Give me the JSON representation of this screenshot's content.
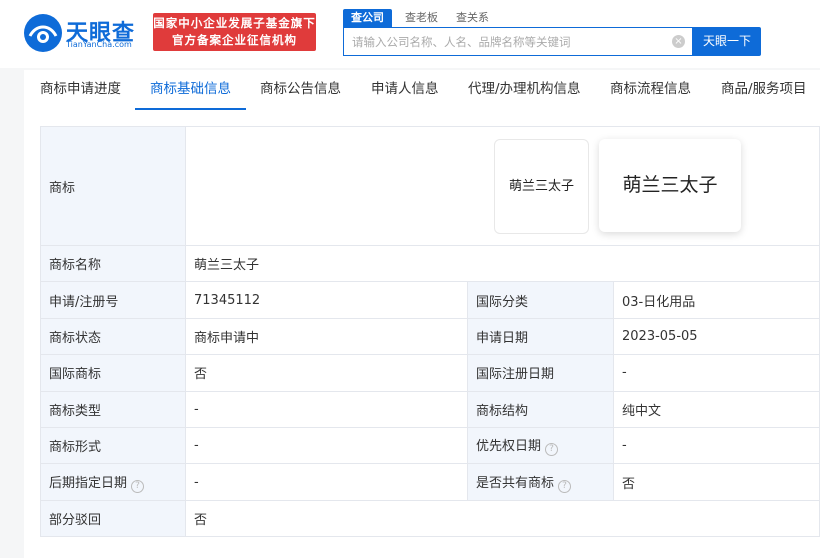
{
  "header": {
    "logo_title": "天眼查",
    "logo_sub": "TianYanCha.com",
    "banner_line1": "国家中小企业发展子基金旗下",
    "banner_line2": "官方备案企业征信机构",
    "search_tabs": [
      "查公司",
      "查老板",
      "查关系"
    ],
    "search_placeholder": "请输入公司名称、人名、品牌名称等关键词",
    "search_button": "天眼一下"
  },
  "nav": {
    "tabs": [
      "商标申请进度",
      "商标基础信息",
      "商标公告信息",
      "申请人信息",
      "代理/办理机构信息",
      "商标流程信息",
      "商品/服务项目"
    ],
    "active": "商标基础信息"
  },
  "trademark": {
    "mark_label": "商标",
    "mark_text": "萌兰三太子",
    "rows": [
      {
        "label": "商标名称",
        "value": "萌兰三太子"
      },
      {
        "label": "申请/注册号",
        "value": "71345112",
        "label2": "国际分类",
        "value2": "03-日化用品"
      },
      {
        "label": "商标状态",
        "value": "商标申请中",
        "label2": "申请日期",
        "value2": "2023-05-05"
      },
      {
        "label": "国际商标",
        "value": "否",
        "label2": "国际注册日期",
        "value2": "-"
      },
      {
        "label": "商标类型",
        "value": "-",
        "label2": "商标结构",
        "value2": "纯中文"
      },
      {
        "label": "商标形式",
        "value": "-",
        "label2": "优先权日期",
        "value2": "-"
      },
      {
        "label": "后期指定日期",
        "value": "-",
        "label2": "是否共有商标",
        "value2": "否"
      },
      {
        "label": "部分驳回",
        "value": "否"
      }
    ]
  },
  "icons": {
    "help": "question-circle-icon",
    "clear": "close-circle-icon",
    "logo": "eye-logo-icon"
  },
  "colors": {
    "brand": "#0e6bd8",
    "banner": "#e03b3b",
    "label_bg": "#f2f6fc"
  }
}
